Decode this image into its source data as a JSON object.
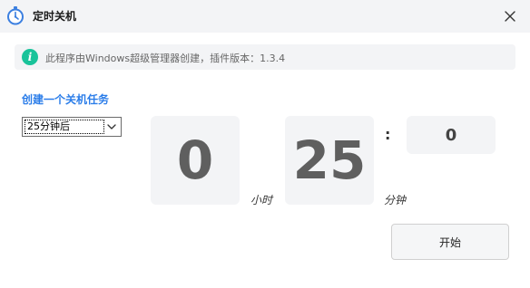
{
  "window": {
    "title": "定时关机",
    "app_icon": "stopwatch-icon",
    "close_icon": "close-icon"
  },
  "info": {
    "icon": "info-icon",
    "icon_glyph": "i",
    "text": "此程序由Windows超级管理器创建，插件版本：1.3.4"
  },
  "task": {
    "section_title": "创建一个关机任务",
    "selected_option": "25分钟后"
  },
  "timer": {
    "hours": "0",
    "hours_unit": "小时",
    "minutes": "25",
    "minutes_unit": "分钟",
    "separator": ":",
    "seconds": "0"
  },
  "actions": {
    "start_label": "开始"
  },
  "colors": {
    "accent": "#2b7de9",
    "info_icon_bg": "#19c39a",
    "card_bg": "#f3f4f6",
    "titlebar_bg": "#f3f4f6"
  }
}
